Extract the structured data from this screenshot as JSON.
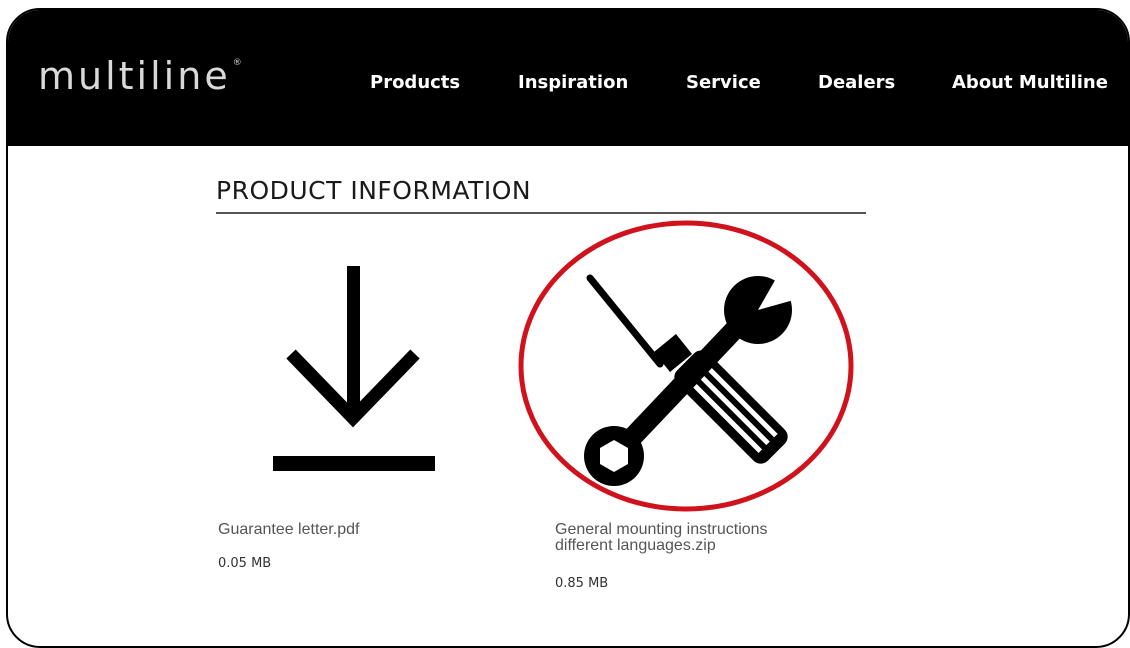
{
  "header": {
    "logo_text": "multiline",
    "logo_mark": "®",
    "nav": [
      {
        "label": "Products"
      },
      {
        "label": "Inspiration"
      },
      {
        "label": "Service"
      },
      {
        "label": "Dealers"
      },
      {
        "label": "About Multiline"
      }
    ]
  },
  "main": {
    "section_title": "PRODUCT INFORMATION",
    "files": [
      {
        "name": "Guarantee letter.pdf",
        "size": "0.05 MB",
        "icon": "download-icon"
      },
      {
        "name_line1": "General mounting instructions",
        "name_line2": "different languages.zip",
        "size": "0.85 MB",
        "icon": "tools-icon"
      }
    ]
  },
  "colors": {
    "header_bg": "#000000",
    "annotation_circle": "#d0121c",
    "text_gray": "#555555"
  }
}
